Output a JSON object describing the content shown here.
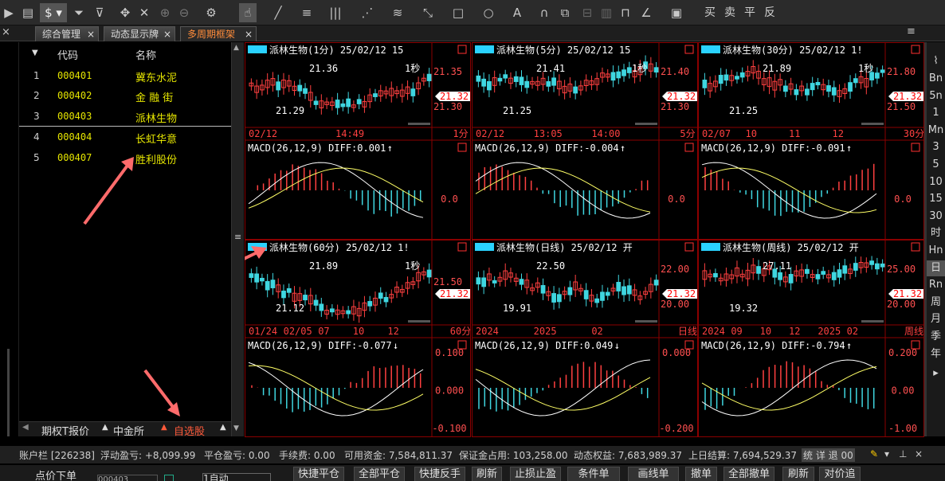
{
  "toolbar": {
    "icons": [
      "play-icon",
      "document-icon",
      "dollar-icon",
      "filter-icon",
      "filter-clear-icon",
      "move-icon",
      "crosshair-icon",
      "zoom-in-icon",
      "zoom-out-icon",
      "gear-icon",
      "cursor-icon",
      "line-icon",
      "fib-icon",
      "vertical-lines-icon",
      "fan-icon",
      "channel-icon",
      "measure-icon",
      "rectangle-icon",
      "circle-icon",
      "text-icon",
      "magnet-icon",
      "copy-icon",
      "lock-icon",
      "trash-icon",
      "pen-icon",
      "save-icon"
    ],
    "trade_buttons": [
      "买",
      "卖",
      "平",
      "反"
    ]
  },
  "tabs": [
    {
      "label": "综合管理"
    },
    {
      "label": "动态显示牌"
    },
    {
      "label": "多周期框架"
    }
  ],
  "list": {
    "headers": {
      "code": "代码",
      "name": "名称"
    },
    "rows": [
      {
        "num": "1",
        "code": "000401",
        "name": "冀东水泥"
      },
      {
        "num": "2",
        "code": "000402",
        "name": "金 融 街"
      },
      {
        "num": "3",
        "code": "000403",
        "name": "派林生物"
      },
      {
        "num": "4",
        "code": "000404",
        "name": "长虹华意"
      },
      {
        "num": "5",
        "code": "000407",
        "name": "胜利股份"
      }
    ]
  },
  "bottom_tabs": [
    "期权T报价",
    "中金所",
    "自选股"
  ],
  "panels": [
    {
      "title": "派林生物(1分) 25/02/12 15",
      "hi": "21.36",
      "lo": "21.29",
      "sec": "1秒",
      "price": "21.32",
      "axis": [
        "21.35",
        "21.30"
      ],
      "x_labels": [
        "02/12",
        "14:49"
      ],
      "period": "1分",
      "macd": "MACD(26,12,9) DIFF:0.001",
      "arrow": "↑",
      "macd_axis": [
        "0.0"
      ]
    },
    {
      "title": "派林生物(5分) 25/02/12 15",
      "hi": "21.41",
      "lo": "21.25",
      "sec": "1秒",
      "price": "21.32",
      "axis": [
        "21.40",
        "21.30"
      ],
      "x_labels": [
        "02/12",
        "13:05",
        "14:00"
      ],
      "period": "5分",
      "macd": "MACD(26,12,9) DIFF:-0.004",
      "arrow": "↑",
      "macd_axis": [
        "0.0"
      ]
    },
    {
      "title": "派林生物(30分) 25/02/12 1!",
      "hi": "21.89",
      "lo": "21.25",
      "sec": "1秒",
      "price": "21.32",
      "axis": [
        "21.80",
        "21.50"
      ],
      "x_labels": [
        "02/07",
        "10",
        "11",
        "12"
      ],
      "period": "30分",
      "macd": "MACD(26,12,9) DIFF:-0.091",
      "arrow": "↑",
      "macd_axis": [
        "0.0"
      ]
    },
    {
      "title": "派林生物(60分) 25/02/12 1!",
      "hi": "21.89",
      "lo": "21.12",
      "sec": "1秒",
      "price": "21.32",
      "axis": [
        "21.50"
      ],
      "x_labels": [
        "01/24",
        "02/05",
        "07",
        "10",
        "12"
      ],
      "period": "60分",
      "macd": "MACD(26,12,9) DIFF:-0.077",
      "arrow": "↓",
      "macd_axis": [
        "0.100",
        "0.000",
        "-0.100"
      ]
    },
    {
      "title": "派林生物(日线) 25/02/12 开",
      "hi": "22.50",
      "lo": "19.91",
      "sec": "",
      "price": "21.32",
      "axis": [
        "22.00",
        "20.00"
      ],
      "x_labels": [
        "2024",
        "2025",
        "02"
      ],
      "period": "日线",
      "macd": "MACD(26,12,9) DIFF:0.049",
      "arrow": "↓",
      "macd_axis": [
        "0.000",
        "-0.200"
      ]
    },
    {
      "title": "派林生物(周线) 25/02/12 开",
      "hi": "27.11",
      "lo": "19.32",
      "sec": "",
      "price": "21.32",
      "axis": [
        "25.00",
        "20.00"
      ],
      "x_labels": [
        "2024",
        "09",
        "10",
        "12",
        "2025",
        "02"
      ],
      "period": "周线",
      "macd": "MACD(26,12,9) DIFF:-0.794",
      "arrow": "↑",
      "macd_axis": [
        "0.200",
        "0.00",
        "-1.00"
      ]
    }
  ],
  "rightbar": [
    "Bn",
    "5n",
    "1",
    "Mn",
    "3",
    "5",
    "10",
    "15",
    "30",
    "时",
    "Hn",
    "日",
    "Rn",
    "周",
    "月",
    "季",
    "年"
  ],
  "status": {
    "account": "账户栏 [226238]",
    "float_pl": "浮动盈亏: +8,099.99",
    "close_pl": "平仓盈亏: 0.00",
    "fee": "手续费: 0.00",
    "avail": "可用资金: 7,584,811.37",
    "margin": "保证金占用: 103,258.00",
    "equity": "动态权益: 7,683,989.37",
    "settle": "上日结算: 7,694,529.37",
    "tail": "统 详 退 00"
  },
  "actions": {
    "left": "点价下单",
    "code": "000403",
    "auto": "1自动",
    "buttons": [
      "快捷平仓",
      "全部平仓",
      "快捷反手",
      "刷新",
      "止损止盈",
      "条件单",
      "画线单",
      "撤单",
      "全部撤单",
      "刷新",
      "对价追"
    ]
  }
}
